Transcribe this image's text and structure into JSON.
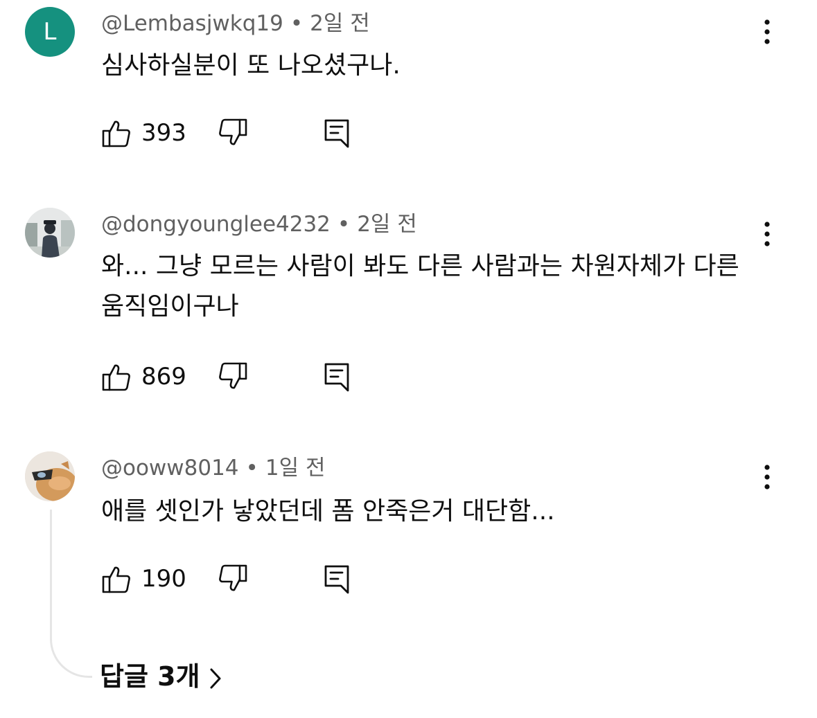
{
  "comments": [
    {
      "avatar_letter": "L",
      "avatar_color": "#15917f",
      "author": "@Lembasjwkq19",
      "time": "2일 전",
      "text": "심사하실분이 또 나오셨구나.",
      "likes": "393"
    },
    {
      "author": "@dongyounglee4232",
      "time": "2일 전",
      "text": "와... 그냥 모르는 사람이 봐도 다른 사람과는  차원자체가 다른 움직임이구나",
      "likes": "869"
    },
    {
      "author": "@ooww8014",
      "time": "1일 전",
      "text": "애를 셋인가 낳았던데 폼 안죽은거 대단함...",
      "likes": "190",
      "replies_label": "답글 3개"
    }
  ],
  "icons": {
    "like": "thumbs-up-icon",
    "dislike": "thumbs-down-icon",
    "reply": "reply-icon",
    "more": "more-vertical-icon",
    "replies_arrow": "chevron-right-icon"
  },
  "colors": {
    "text": "#0f0f0f",
    "meta": "#606060",
    "thread": "#e5e5e5"
  }
}
